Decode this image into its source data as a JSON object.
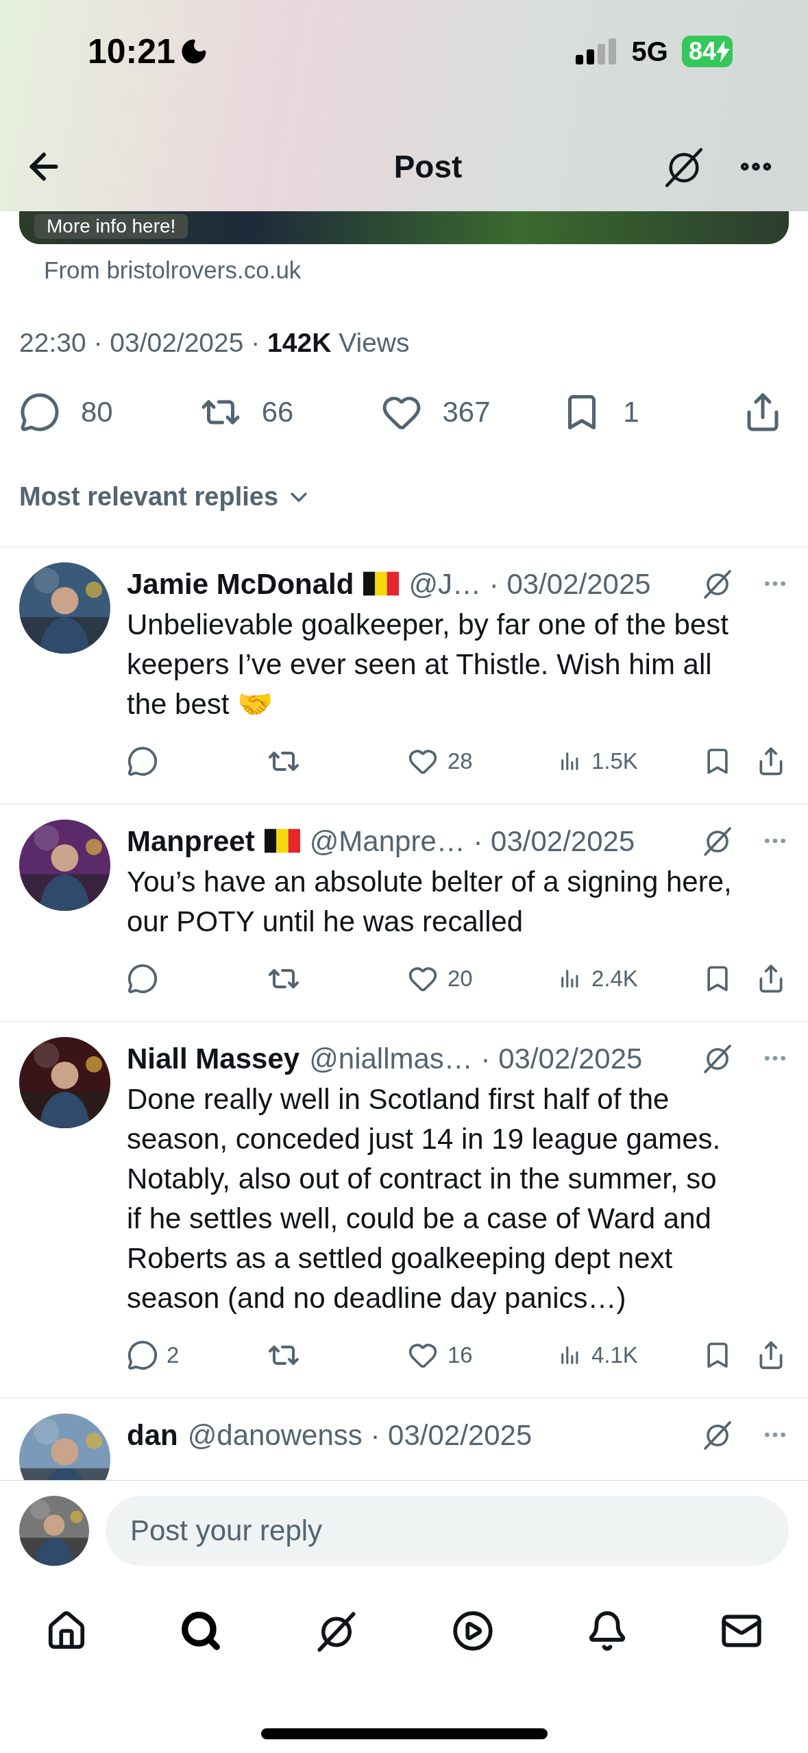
{
  "status_bar": {
    "time": "10:21",
    "network": "5G",
    "battery": "84"
  },
  "header": {
    "title": "Post"
  },
  "link_card": {
    "caption": "More info here!",
    "source": "From bristolrovers.co.uk"
  },
  "post_meta": "22:30 · 03/02/2025 · **142K** Views",
  "post_actions": [
    {
      "kind": "reply",
      "count": "80"
    },
    {
      "kind": "repost",
      "count": "66"
    },
    {
      "kind": "like",
      "count": "367"
    },
    {
      "kind": "bookmark",
      "count": "1"
    },
    {
      "kind": "share"
    }
  ],
  "sort": {
    "label": "Most relevant replies"
  },
  "replies": [
    {
      "name": "Jamie McDonald",
      "flag": true,
      "meta": "@J… · 03/02/2025",
      "lines": [
        "Unbelievable goalkeeper, by far one of the best",
        "keepers I’ve ever seen at Thistle. Wish him all",
        "the best 🤝"
      ],
      "likes": "28",
      "views": "1.5K"
    },
    {
      "name": "Manpreet",
      "flag": true,
      "meta": "@Manpre… · 03/02/2025",
      "lines": [
        "You’s have an absolute belter of a signing here,",
        "our POTY until he was recalled"
      ],
      "likes": "20",
      "views": "2.4K"
    },
    {
      "name": "Niall Massey",
      "flag": false,
      "meta": "@niallmas… · 03/02/2025",
      "lines": [
        "Done really well in Scotland first half of the",
        "season, conceded just 14 in 19 league games.",
        "Notably, also out of contract in the summer, so",
        "if he settles well, could be a case of Ward and",
        "Roberts as a settled goalkeeping dept next",
        "season (and no deadline day panics…)"
      ],
      "replies": "2",
      "likes": "16",
      "views": "4.1K"
    },
    {
      "name": "dan",
      "flag": false,
      "meta": "@danowenss · 03/02/2025"
    }
  ],
  "composer": {
    "placeholder": "Post your reply"
  },
  "tab_bar": [
    {
      "kind": "home",
      "selected": false
    },
    {
      "kind": "search",
      "selected": true
    },
    {
      "kind": "grok",
      "selected": false
    },
    {
      "kind": "video",
      "selected": false
    },
    {
      "kind": "notifications",
      "selected": false
    },
    {
      "kind": "messages",
      "selected": false
    }
  ]
}
